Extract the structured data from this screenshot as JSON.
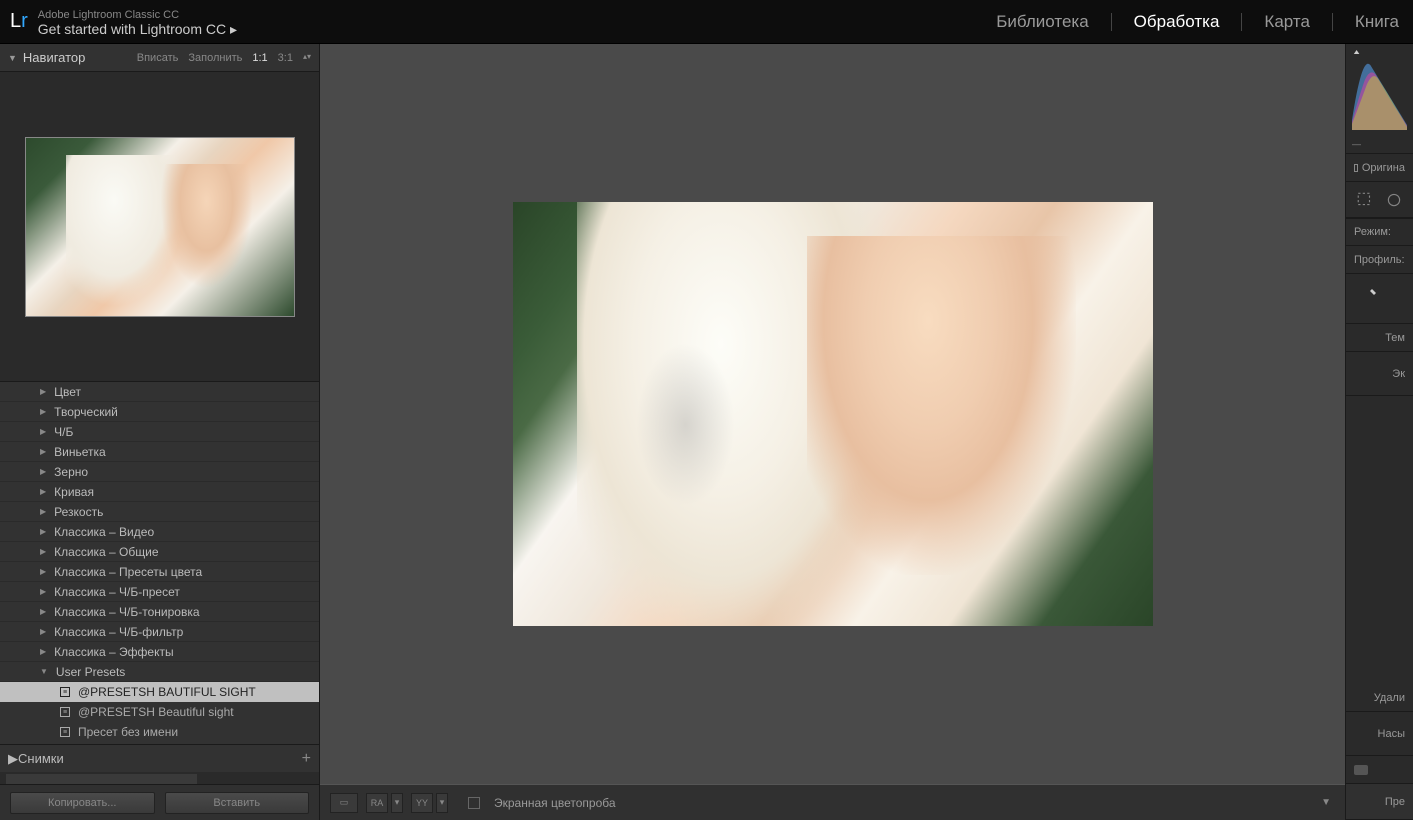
{
  "app": {
    "name": "Adobe Lightroom Classic CC",
    "subtitle": "Get started with Lightroom CC ▸",
    "logo_l": "L",
    "logo_r": "r"
  },
  "modules": {
    "library": "Библиотека",
    "develop": "Обработка",
    "map": "Карта",
    "book": "Книга"
  },
  "navigator": {
    "title": "Навигатор",
    "fit": "Вписать",
    "fill": "Заполнить",
    "one": "1:1",
    "three": "3:1"
  },
  "presets": {
    "items": [
      {
        "label": "Цвет"
      },
      {
        "label": "Творческий"
      },
      {
        "label": "Ч/Б"
      },
      {
        "label": "Виньетка"
      },
      {
        "label": "Зерно"
      },
      {
        "label": "Кривая"
      },
      {
        "label": "Резкость"
      },
      {
        "label": "Классика – Видео"
      },
      {
        "label": "Классика – Общие"
      },
      {
        "label": "Классика – Пресеты цвета"
      },
      {
        "label": "Классика – Ч/Б-пресет"
      },
      {
        "label": "Классика – Ч/Б-тонировка"
      },
      {
        "label": "Классика – Ч/Б-фильтр"
      },
      {
        "label": "Классика – Эффекты"
      }
    ],
    "user_group": "User Presets",
    "children": [
      {
        "label": "@PRESETSH BAUTIFUL SIGHT",
        "selected": true
      },
      {
        "label": "@PRESETSH Beautiful sight",
        "selected": false
      },
      {
        "label": "Пресет без имени",
        "selected": false
      }
    ]
  },
  "snapshots": {
    "title": "Снимки"
  },
  "buttons": {
    "copy": "Копировать...",
    "paste": "Вставить"
  },
  "toolbar": {
    "proof": "Экранная цветопроба",
    "ra": "RA",
    "yy": "YY"
  },
  "right": {
    "original": "Оригина",
    "mode": "Режим:",
    "profile": "Профиль:",
    "temp": "Тем",
    "exp": "Эк",
    "delete": "Удали",
    "sat": "Насы",
    "pre": "Пре"
  }
}
